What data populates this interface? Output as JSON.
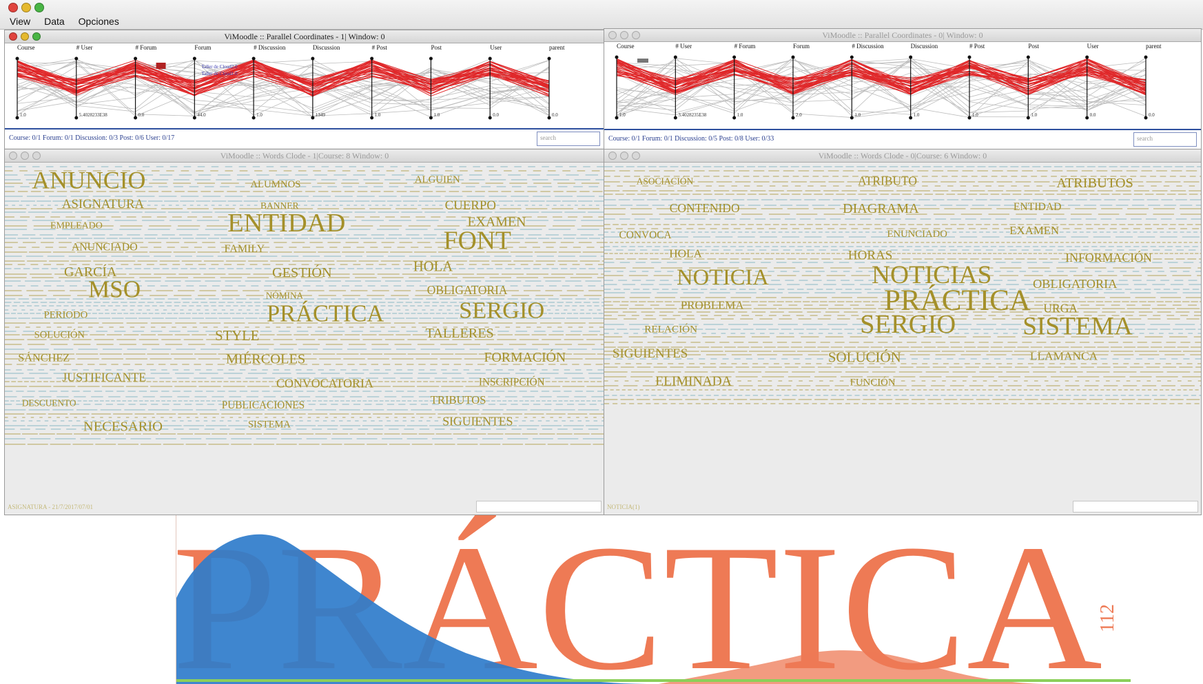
{
  "menubar": {
    "items": [
      "View",
      "Data",
      "Opciones"
    ]
  },
  "pc_left": {
    "title": "ViMoodle :: Parallel Coordinates -  1| Window: 0",
    "axes": [
      {
        "label": "Course",
        "top": "",
        "bottom": "1.0"
      },
      {
        "label": "# User",
        "top": "",
        "bottom": "5.4028233E38"
      },
      {
        "label": "# Forum",
        "top": "",
        "bottom": "0.0"
      },
      {
        "label": "Forum",
        "top": "",
        "bottom": "44.0"
      },
      {
        "label": "# Discussion",
        "top": "",
        "bottom": "1.0"
      },
      {
        "label": "Discussion",
        "top": "",
        "bottom": "1349"
      },
      {
        "label": "# Post",
        "top": "",
        "bottom": "1.0"
      },
      {
        "label": "Post",
        "top": "",
        "bottom": "1.0"
      },
      {
        "label": "User",
        "top": "",
        "bottom": "0.0"
      },
      {
        "label": "parent",
        "top": "",
        "bottom": "0.0"
      }
    ],
    "annotations": [
      "Taller de Cloud2.0",
      "Taller de Cloud1.0"
    ],
    "status": "Course: 0/1 Forum: 0/1 Discussion: 0/3 Post: 0/6 User: 0/17",
    "search_placeholder": "search"
  },
  "pc_right": {
    "title": "ViMoodle :: Parallel Coordinates -  0| Window: 0",
    "axes": [
      {
        "label": "Course",
        "top": "",
        "bottom": "1.0"
      },
      {
        "label": "# User",
        "top": "",
        "bottom": "3.4028235E38"
      },
      {
        "label": "# Forum",
        "top": "",
        "bottom": "1.0"
      },
      {
        "label": "Forum",
        "top": "",
        "bottom": "2.0"
      },
      {
        "label": "# Discussion",
        "top": "",
        "bottom": "1.0"
      },
      {
        "label": "Discussion",
        "top": "",
        "bottom": "1.0"
      },
      {
        "label": "# Post",
        "top": "",
        "bottom": "1.0"
      },
      {
        "label": "Post",
        "top": "",
        "bottom": "1.0"
      },
      {
        "label": "User",
        "top": "",
        "bottom": "0.0"
      },
      {
        "label": "parent",
        "top": "",
        "bottom": "0.0"
      }
    ],
    "status": "Course: 0/1 Forum: 0/1 Discussion: 0/5 Post: 0/8 User: 0/33",
    "search_placeholder": "search"
  },
  "cloud_left": {
    "title": "ViMoodle :: Words Clode - 1|Course: 8 Window: 0",
    "words": [
      "ANUNCIO",
      "ALUMNOS",
      "ALGUIEN",
      "ASIGNATURA",
      "BANNER",
      "CUERPO",
      "EMPLEADO",
      "ENTIDAD",
      "EXAMEN",
      "ANUNCIADO",
      "FAMILY",
      "FONT",
      "GARCÍA",
      "GESTIÓN",
      "HOLA",
      "MSO",
      "NÓMINA",
      "OBLIGATORIA",
      "PERIODO",
      "PRÁCTICA",
      "SERGIO",
      "SOLUCIÓN",
      "STYLE",
      "TALLERES",
      "SÁNCHEZ",
      "MIÉRCOLES",
      "FORMACIÓN",
      "JUSTIFICANTE",
      "CONVOCATORIA",
      "INSCRIPCIÓN",
      "DESCUENTO",
      "PUBLICACIONES",
      "TRIBUTOS",
      "NECESARIO",
      "SISTEMA",
      "SIGUIENTES"
    ],
    "footer": "ASIGNATURA - 21/7/2017/07/01"
  },
  "cloud_right": {
    "title": "ViMoodle :: Words Clode - 0|Course: 6 Window: 0",
    "words": [
      "ASOCIACIÓN",
      "ATRIBUTO",
      "ATRIBUTOS",
      "CONTENIDO",
      "DIAGRAMA",
      "ENTIDAD",
      "CONVOCA",
      "ENUNCIADO",
      "EXAMEN",
      "HOLA",
      "HORAS",
      "INFORMACIÓN",
      "NOTICIA",
      "NOTICIAS",
      "OBLIGATORIA",
      "PROBLEMA",
      "PRÁCTICA",
      "URGA",
      "RELACIÓN",
      "SERGIO",
      "SISTEMA",
      "SIGUIENTES",
      "SOLUCIÓN",
      "LLAMANCA",
      "ELIMINADA",
      "FUNCIÓN"
    ],
    "footer": "NOTICIA(1)"
  },
  "zoom_word": "PRÁCTICA",
  "zoom_number": "112",
  "colors": {
    "word": "#a4902a",
    "pc_line": "#e0282a",
    "zoom_word": "#ee7a55",
    "zoom_blue": "#2f7ccb"
  }
}
